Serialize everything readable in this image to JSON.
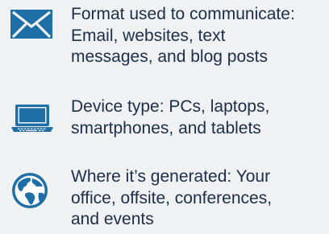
{
  "items": [
    {
      "icon": "envelope-icon",
      "lines": [
        "Format used to communicate:",
        "Email, websites, text",
        "messages, and blog posts"
      ]
    },
    {
      "icon": "laptop-icon",
      "lines": [
        "Device type: PCs, laptops,",
        "smartphones, and tablets"
      ]
    },
    {
      "icon": "globe-icon",
      "lines": [
        "Where it’s generated: Your",
        "office, offsite, conferences,",
        "and events"
      ]
    }
  ],
  "colors": {
    "background": "#f0f1f2",
    "text": "#1d2d4a",
    "icon": "#1e6fa8"
  }
}
